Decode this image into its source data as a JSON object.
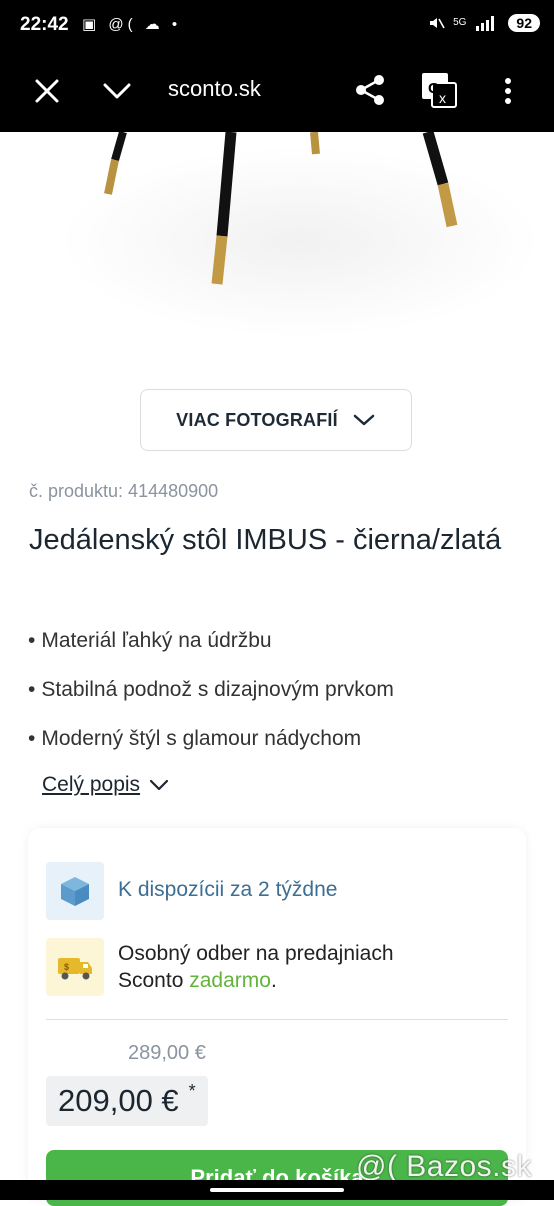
{
  "status_bar": {
    "time": "22:42",
    "left_icons": "▣ @( ☁ •",
    "network": "5G",
    "battery": "92"
  },
  "browser": {
    "url": "sconto.sk"
  },
  "product": {
    "more_photos_label": "VIAC FOTOGRAFIÍ",
    "number": "č. produktu: 414480900",
    "title": "Jedálenský stôl IMBUS - čierna/zlatá",
    "features": [
      "Materiál ľahký na údržbu",
      "Stabilná podnož s dizajnovým prvkom",
      "Moderný štýl s glamour nádychom"
    ],
    "bullet": "•",
    "full_description_link": "Celý popis"
  },
  "purchase": {
    "availability": "K dispozícii za 2 týždne",
    "pickup_line1": "Osobný odber na predajniach",
    "pickup_line2_prefix": "Sconto",
    "pickup_free": "zadarmo",
    "pickup_suffix": ".",
    "old_price": "289,00 €",
    "price": "209,00 €",
    "price_note_mark": "*",
    "buy_button": "Pridať do košíka"
  },
  "watermark": "@( Bazos.sk",
  "colors": {
    "accent_green": "#4ab548",
    "free_green": "#63b33d",
    "availability_blue": "#3d6e93"
  }
}
